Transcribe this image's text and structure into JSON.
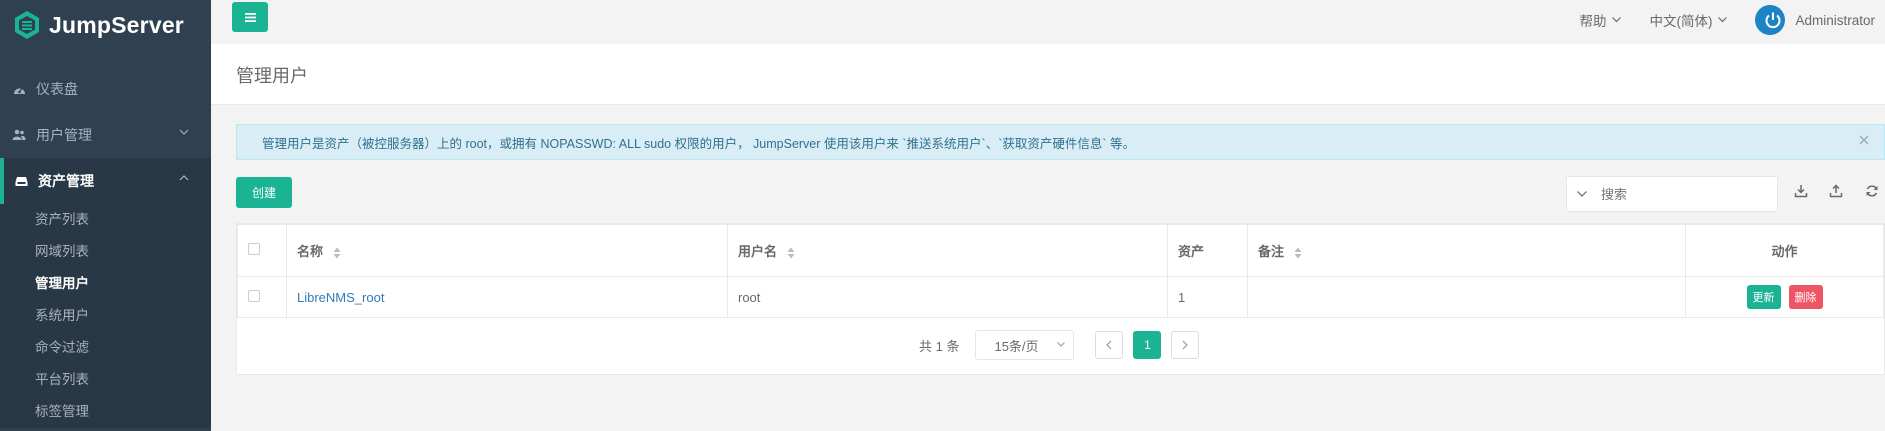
{
  "brand": {
    "name": "JumpServer"
  },
  "sidebar": {
    "items": [
      {
        "label": "仪表盘",
        "icon": "dashboard-icon"
      },
      {
        "label": "用户管理",
        "icon": "users-icon"
      },
      {
        "label": "资产管理",
        "icon": "inbox-icon"
      }
    ],
    "sub_items": [
      "资产列表",
      "网域列表",
      "管理用户",
      "系统用户",
      "命令过滤",
      "平台列表",
      "标签管理"
    ],
    "active_sub": "管理用户"
  },
  "topbar": {
    "help_label": "帮助",
    "language_label": "中文(简体)",
    "user_label": "Administrator"
  },
  "page": {
    "title": "管理用户"
  },
  "alert": {
    "text": "管理用户是资产（被控服务器）上的 root，或拥有 NOPASSWD: ALL sudo 权限的用户， JumpServer 使用该用户来 `推送系统用户`、`获取资产硬件信息` 等。"
  },
  "toolbar": {
    "create_label": "创建",
    "search_placeholder": "搜索"
  },
  "table": {
    "columns": [
      "名称",
      "用户名",
      "资产",
      "备注",
      "动作"
    ],
    "rows": [
      {
        "name": "LibreNMS_root",
        "username": "root",
        "assets": "1",
        "comment": "",
        "update_label": "更新",
        "delete_label": "删除"
      }
    ]
  },
  "pagination": {
    "total_text": "共 1 条",
    "page_size": "15条/页",
    "current_page": "1"
  },
  "colors": {
    "accent": "#1ab394",
    "danger": "#ed5565",
    "sidebar": "#2f4050",
    "link": "#337ab7"
  }
}
